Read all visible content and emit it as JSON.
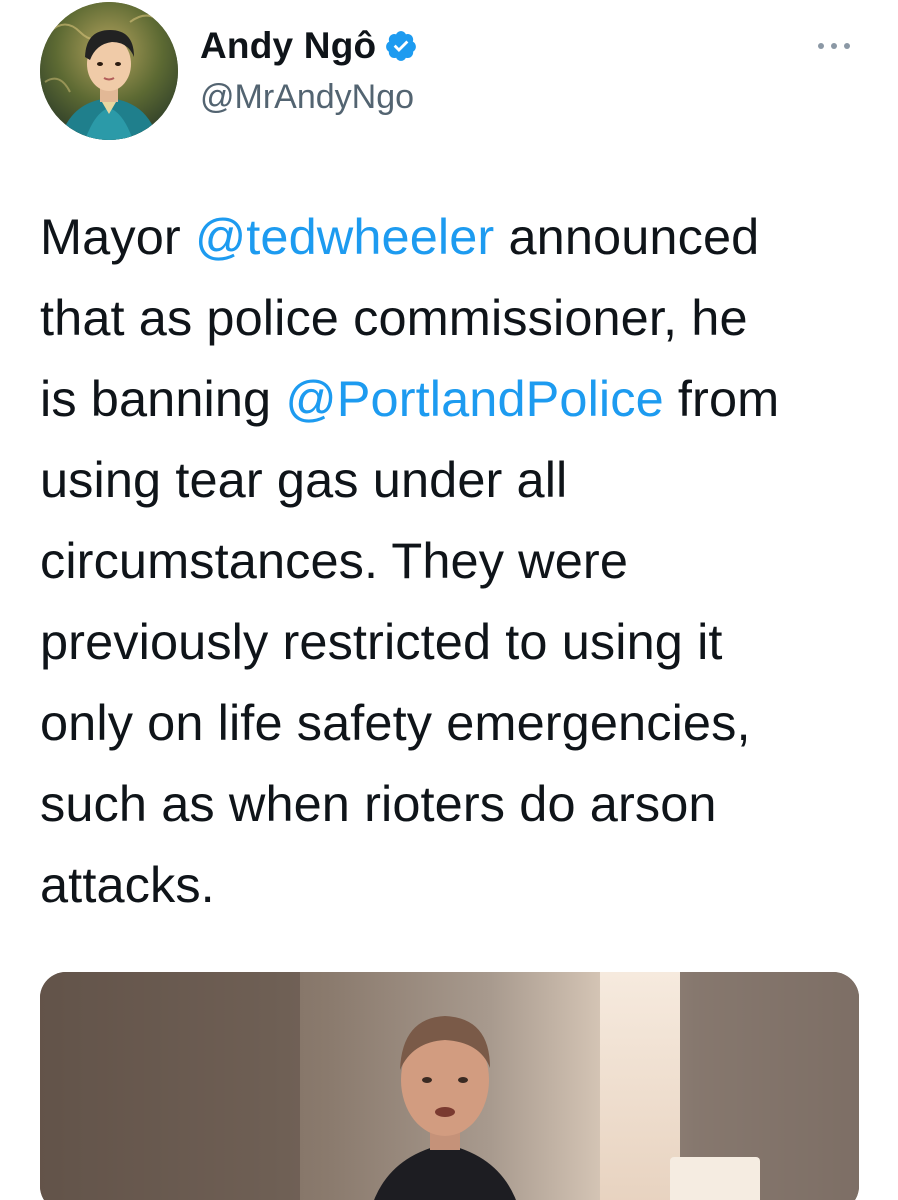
{
  "author": {
    "display_name": "Andy Ngô",
    "handle": "@MrAndyNgo",
    "verified": true,
    "avatar_icon": "avatar-illustration"
  },
  "actions": {
    "more_icon": "more-horizontal-icon"
  },
  "tweet": {
    "lines": [
      [
        {
          "t": "Mayor "
        },
        {
          "t": "@tedwheeler",
          "m": true
        },
        {
          "t": " announced"
        }
      ],
      [
        {
          "t": "that as police commissioner, he"
        }
      ],
      [
        {
          "t": "is banning "
        },
        {
          "t": "@PortlandPolice",
          "m": true
        },
        {
          "t": " from"
        }
      ],
      [
        {
          "t": "using tear gas under all"
        }
      ],
      [
        {
          "t": "circumstances. They were"
        }
      ],
      [
        {
          "t": "previously restricted to using it"
        }
      ],
      [
        {
          "t": "only on life safety emergencies,"
        }
      ],
      [
        {
          "t": "such as when rioters do arson"
        }
      ],
      [
        {
          "t": "attacks."
        }
      ]
    ]
  },
  "media": {
    "type": "video-thumbnail",
    "icon": "video-preview"
  },
  "colors": {
    "mention": "#1d9bf0",
    "verified": "#1d9bf0",
    "secondary_text": "#536471",
    "primary_text": "#0f1419"
  }
}
